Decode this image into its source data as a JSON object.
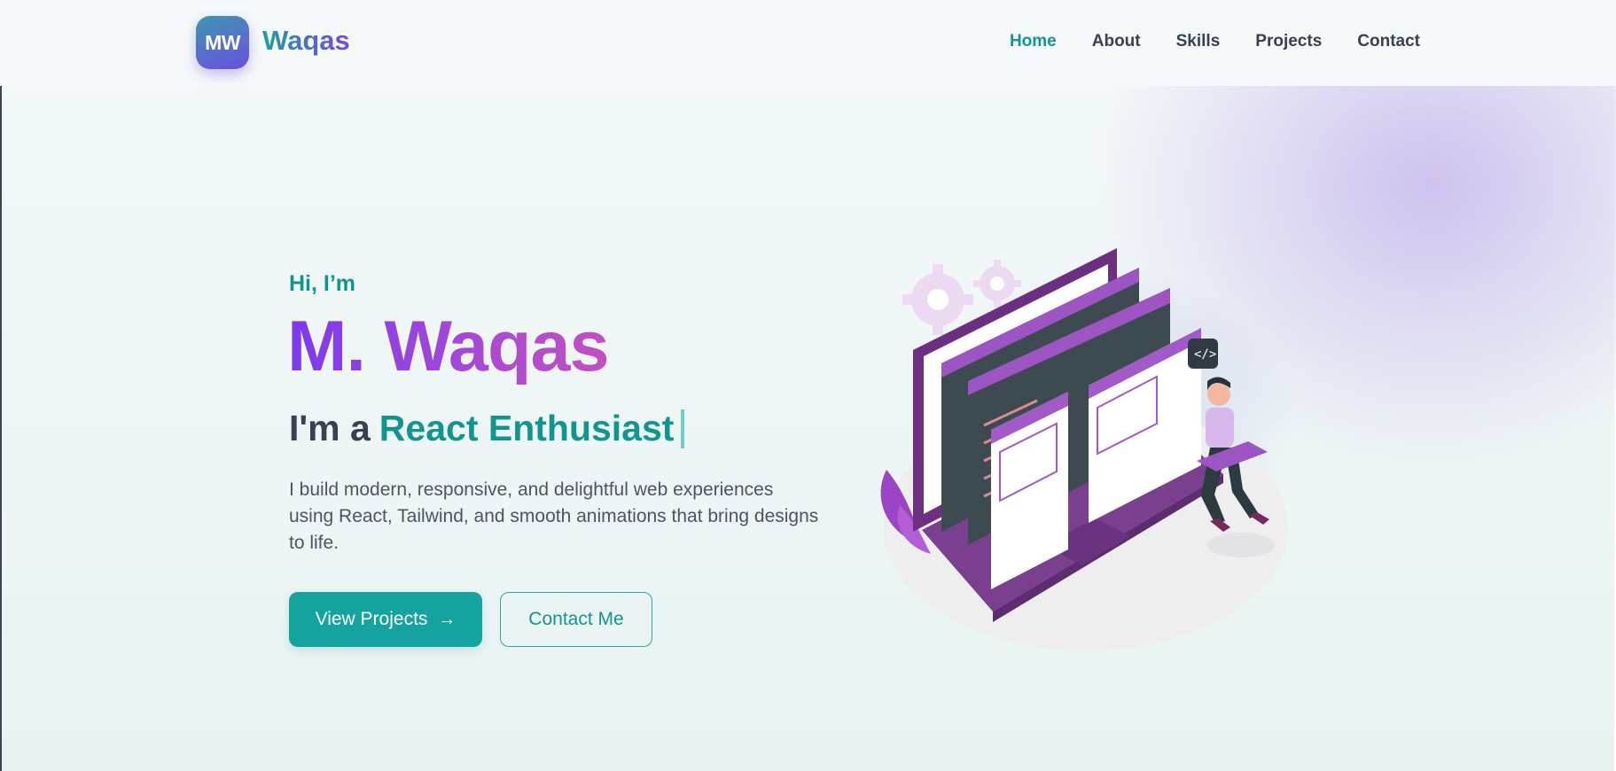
{
  "header": {
    "logo_text": "MW",
    "brand": "Waqas",
    "nav": [
      {
        "label": "Home",
        "active": true
      },
      {
        "label": "About",
        "active": false
      },
      {
        "label": "Skills",
        "active": false
      },
      {
        "label": "Projects",
        "active": false
      },
      {
        "label": "Contact",
        "active": false
      }
    ]
  },
  "hero": {
    "greeting": "Hi, I’m",
    "name": "M. Waqas",
    "role_prefix": "I'm a",
    "role_highlight": "React Enthusiast",
    "description": "I build modern, responsive, and delightful web experiences using React, Tailwind, and smooth animations that bring designs to life.",
    "primary_button": "View Projects",
    "secondary_button": "Contact Me",
    "illustration_icon": "developer-laptop-illustration"
  },
  "colors": {
    "accent": "#13958f",
    "button_bg": "#15a3a0",
    "name_gradient_start": "#7c3aed",
    "name_gradient_end": "#c24fc0",
    "text_dark": "#374151"
  }
}
